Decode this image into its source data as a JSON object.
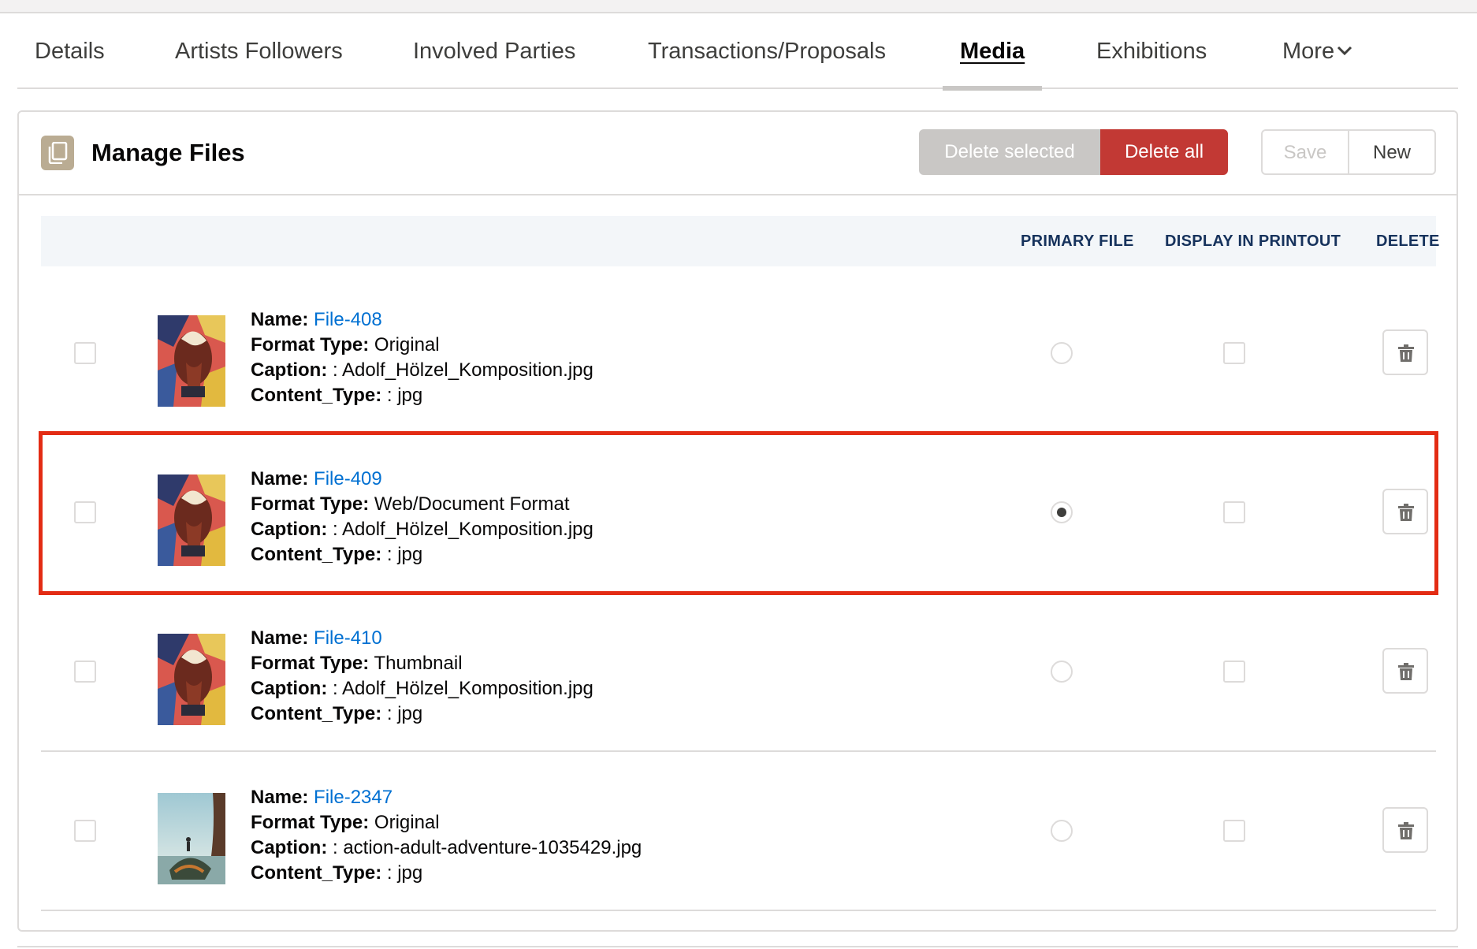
{
  "tabs": [
    {
      "label": "Details",
      "active": false
    },
    {
      "label": "Artists Followers",
      "active": false
    },
    {
      "label": "Involved Parties",
      "active": false
    },
    {
      "label": "Transactions/Proposals",
      "active": false
    },
    {
      "label": "Media",
      "active": true
    },
    {
      "label": "Exhibitions",
      "active": false
    },
    {
      "label": "More",
      "active": false
    }
  ],
  "card": {
    "title": "Manage Files",
    "icon": "file-copy-icon",
    "buttons": {
      "delete_selected": "Delete selected",
      "delete_all": "Delete all",
      "save": "Save",
      "new": "New"
    }
  },
  "table": {
    "headers": {
      "primary_file": "PRIMARY FILE",
      "display_in_printout": "DISPLAY IN PRINTOUT",
      "delete": "DELETE"
    },
    "labels": {
      "name": "Name:",
      "format_type": "Format Type:",
      "caption": "Caption:",
      "content_type": "Content_Type:"
    },
    "rows": [
      {
        "name": "File-408",
        "format_type": "Original",
        "caption": ": Adolf_Hölzel_Komposition.jpg",
        "content_type": ": jpg",
        "primary": false,
        "printout": false,
        "thumbnail": "abstract-painting"
      },
      {
        "name": "File-409",
        "format_type": "Web/Document Format",
        "caption": ": Adolf_Hölzel_Komposition.jpg",
        "content_type": ": jpg",
        "primary": true,
        "printout": false,
        "thumbnail": "abstract-painting"
      },
      {
        "name": "File-410",
        "format_type": "Thumbnail",
        "caption": ": Adolf_Hölzel_Komposition.jpg",
        "content_type": ": jpg",
        "primary": false,
        "printout": false,
        "thumbnail": "abstract-painting"
      },
      {
        "name": "File-2347",
        "format_type": "Original",
        "caption": ": action-adult-adventure-1035429.jpg",
        "content_type": ": jpg",
        "primary": false,
        "printout": false,
        "thumbnail": "landscape-photo"
      }
    ]
  },
  "colors": {
    "accent_link": "#0070d2",
    "danger": "#c23934",
    "highlight": "#e32c14"
  }
}
